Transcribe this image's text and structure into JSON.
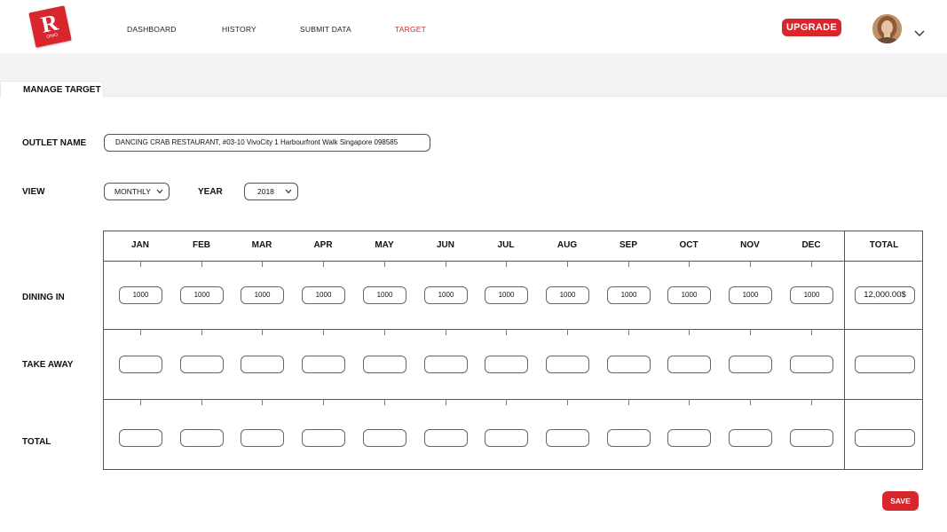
{
  "brand": {
    "logo_letter": "R",
    "logo_sub": "ONIO"
  },
  "colors": {
    "accent": "#d8262c",
    "band": "#f3f3f3",
    "border": "#555555"
  },
  "nav": {
    "items": [
      {
        "label": "DASHBOARD",
        "active": false
      },
      {
        "label": "HISTORY",
        "active": false
      },
      {
        "label": "SUBMIT DATA",
        "active": false
      },
      {
        "label": "TARGET",
        "active": true
      }
    ],
    "upgrade_label": "UPGRADE",
    "avatar_icon": "user-avatar",
    "menu_icon": "chevron-down-icon"
  },
  "tab": {
    "label": "MANAGE TARGET"
  },
  "form": {
    "outlet_label": "OUTLET NAME",
    "outlet_value": "DANCING CRAB RESTAURANT, #03-10 VivoCity 1 Harbourfront Walk Singapore 098585",
    "view_label": "VIEW",
    "view_value": "MONTHLY",
    "year_label": "YEAR",
    "year_value": "2018"
  },
  "table": {
    "columns": [
      "JAN",
      "FEB",
      "MAR",
      "APR",
      "MAY",
      "JUN",
      "JUL",
      "AUG",
      "SEP",
      "OCT",
      "NOV",
      "DEC"
    ],
    "total_header": "TOTAL",
    "rows": [
      {
        "label": "DINING IN",
        "values": [
          "1000",
          "1000",
          "1000",
          "1000",
          "1000",
          "1000",
          "1000",
          "1000",
          "1000",
          "1000",
          "1000",
          "1000"
        ],
        "total": "12,000.00$"
      },
      {
        "label": "TAKE AWAY",
        "values": [
          "",
          "",
          "",
          "",
          "",
          "",
          "",
          "",
          "",
          "",
          "",
          ""
        ],
        "total": ""
      },
      {
        "label": "TOTAL",
        "values": [
          "",
          "",
          "",
          "",
          "",
          "",
          "",
          "",
          "",
          "",
          "",
          ""
        ],
        "total": ""
      }
    ]
  },
  "actions": {
    "save_label": "SAVE"
  }
}
